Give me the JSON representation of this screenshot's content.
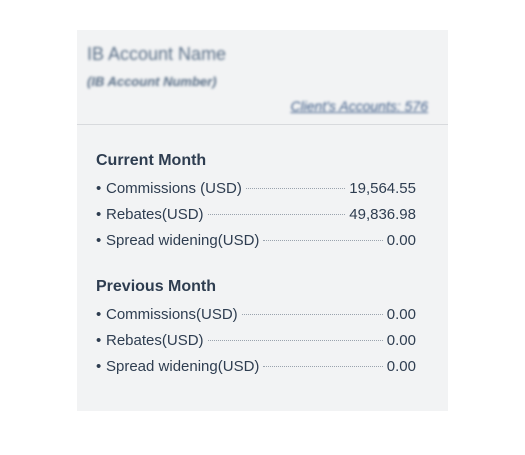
{
  "header": {
    "account_name": "IB Account Name",
    "account_number": "(IB Account Number)",
    "clients_link": "Client's Accounts: 576"
  },
  "current_month": {
    "title": "Current Month",
    "rows": [
      {
        "bullet": "•",
        "label": "Commissions (USD)",
        "value": "19,564.55"
      },
      {
        "bullet": "•",
        "label": "Rebates(USD)",
        "value": "49,836.98"
      },
      {
        "bullet": "•",
        "label": "Spread widening(USD)",
        "value": "0.00"
      }
    ]
  },
  "previous_month": {
    "title": "Previous Month",
    "rows": [
      {
        "bullet": "•",
        "label": "Commissions(USD)",
        "value": "0.00"
      },
      {
        "bullet": "•",
        "label": "Rebates(USD)",
        "value": "0.00"
      },
      {
        "bullet": "•",
        "label": "Spread widening(USD)",
        "value": "0.00"
      }
    ]
  }
}
